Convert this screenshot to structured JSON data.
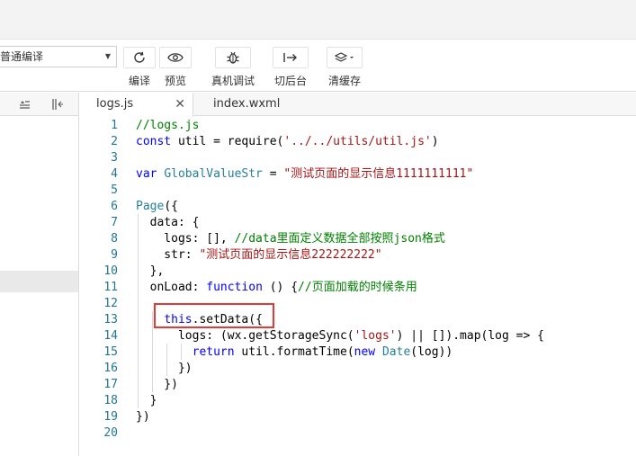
{
  "toolbar": {
    "compile_mode": "普通编译",
    "buttons": [
      {
        "label": "编译",
        "icon": "refresh-icon"
      },
      {
        "label": "预览",
        "icon": "eye-icon"
      },
      {
        "label": "真机调试",
        "icon": "bug-icon"
      },
      {
        "label": "切后台",
        "icon": "switch-icon"
      },
      {
        "label": "清缓存",
        "icon": "layers-icon"
      }
    ]
  },
  "tabs": [
    {
      "label": "logs.js",
      "active": true
    },
    {
      "label": "index.wxml",
      "active": false
    }
  ],
  "editor": {
    "line_numbers": [
      "1",
      "2",
      "3",
      "4",
      "5",
      "6",
      "7",
      "8",
      "9",
      "10",
      "11",
      "12",
      "13",
      "14",
      "15",
      "16",
      "17",
      "18",
      "19",
      "20"
    ],
    "lines": [
      [
        {
          "t": "//logs.js",
          "c": "comment"
        }
      ],
      [
        {
          "t": "const",
          "c": "kw"
        },
        {
          "t": " util = require(",
          "c": "plain"
        },
        {
          "t": "'../../utils/util.js'",
          "c": "str"
        },
        {
          "t": ")",
          "c": "plain"
        }
      ],
      [],
      [
        {
          "t": "var",
          "c": "kw"
        },
        {
          "t": " ",
          "c": "plain"
        },
        {
          "t": "GlobalValueStr",
          "c": "var"
        },
        {
          "t": " = ",
          "c": "plain"
        },
        {
          "t": "\"测试页面的显示信息1111111111\"",
          "c": "str"
        }
      ],
      [],
      [
        {
          "t": "Page",
          "c": "var"
        },
        {
          "t": "({",
          "c": "plain"
        }
      ],
      [
        {
          "t": "  data: {",
          "c": "plain"
        }
      ],
      [
        {
          "t": "    logs: [], ",
          "c": "plain"
        },
        {
          "t": "//data里面定义数据全部按照json格式",
          "c": "comment"
        }
      ],
      [
        {
          "t": "    str: ",
          "c": "plain"
        },
        {
          "t": "\"测试页面的显示信息222222222\"",
          "c": "str"
        }
      ],
      [
        {
          "t": "  },",
          "c": "plain"
        }
      ],
      [
        {
          "t": "  onLoad: ",
          "c": "plain"
        },
        {
          "t": "function",
          "c": "kw"
        },
        {
          "t": " () {",
          "c": "plain"
        },
        {
          "t": "//页面加载的时候条用",
          "c": "comment"
        }
      ],
      [],
      [
        {
          "t": "    ",
          "c": "plain"
        },
        {
          "t": "this",
          "c": "kw"
        },
        {
          "t": ".setData({",
          "c": "plain"
        }
      ],
      [
        {
          "t": "      logs: (wx.getStorageSync(",
          "c": "plain"
        },
        {
          "t": "'logs'",
          "c": "str"
        },
        {
          "t": ") || []).map(log => {",
          "c": "plain"
        }
      ],
      [
        {
          "t": "        ",
          "c": "plain"
        },
        {
          "t": "return",
          "c": "kw"
        },
        {
          "t": " util.formatTime(",
          "c": "plain"
        },
        {
          "t": "new",
          "c": "kw"
        },
        {
          "t": " ",
          "c": "plain"
        },
        {
          "t": "Date",
          "c": "var"
        },
        {
          "t": "(log))",
          "c": "plain"
        }
      ],
      [
        {
          "t": "      })",
          "c": "plain"
        }
      ],
      [
        {
          "t": "    })",
          "c": "plain"
        }
      ],
      [
        {
          "t": "  }",
          "c": "plain"
        }
      ],
      [
        {
          "t": "})",
          "c": "plain"
        }
      ],
      []
    ],
    "highlighted_line": "13"
  },
  "colors": {
    "comment": "#008000",
    "keyword": "#0000ff",
    "string": "#a31515",
    "identifier": "#267f99",
    "line_number": "#237893",
    "highlight_box": "#e53935"
  }
}
